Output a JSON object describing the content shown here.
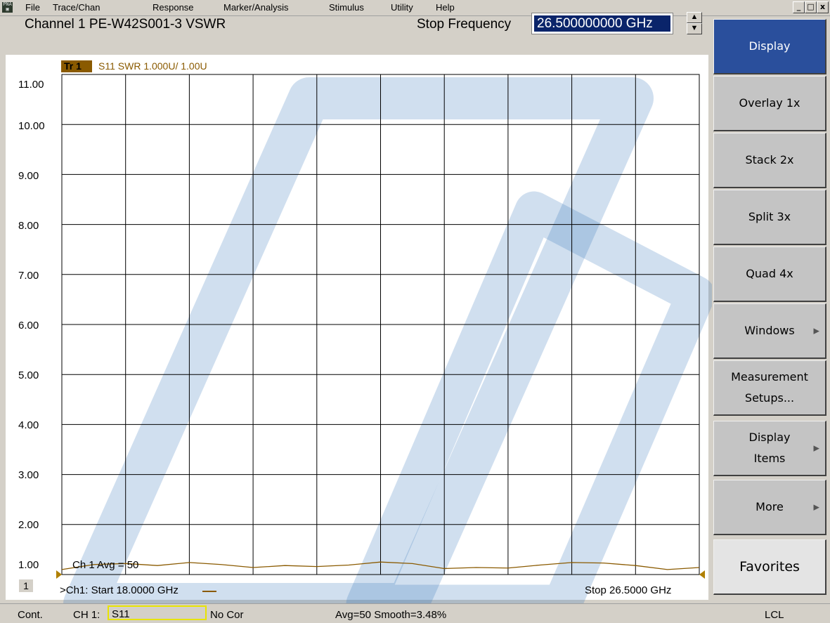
{
  "menubar": {
    "items": [
      "File",
      "Trace/Chan",
      "Response",
      "Marker/Analysis",
      "Stimulus",
      "Utility",
      "Help"
    ],
    "icon": "pna-app-icon",
    "window_buttons": {
      "minimize": "_",
      "restore": "□",
      "close": "x"
    }
  },
  "header": {
    "channel_title": "Channel 1  PE-W42S001-3 VSWR",
    "stop_label": "Stop Frequency",
    "stop_value": "26.500000000 GHz"
  },
  "trace": {
    "tag": "Tr  1",
    "label": "S11 SWR 1.000U/  1.00U",
    "color": "#8a5a00"
  },
  "chart_data": {
    "type": "line",
    "xlabel": "",
    "ylabel": "",
    "xlim": [
      18.0,
      26.5
    ],
    "ylim": [
      1.0,
      11.0
    ],
    "y_ticks": [
      "11.00",
      "10.00",
      "9.00",
      "8.00",
      "7.00",
      "6.00",
      "5.00",
      "4.00",
      "3.00",
      "2.00",
      "1.00"
    ],
    "grid": true,
    "series": [
      {
        "name": "S11",
        "color": "#8a5a00",
        "x": [
          18.0,
          18.425,
          18.85,
          19.275,
          19.7,
          20.125,
          20.55,
          20.975,
          21.4,
          21.825,
          22.25,
          22.675,
          23.1,
          23.525,
          23.95,
          24.375,
          24.8,
          25.225,
          25.65,
          26.075,
          26.5
        ],
        "y": [
          1.1,
          1.2,
          1.22,
          1.18,
          1.24,
          1.2,
          1.14,
          1.18,
          1.16,
          1.19,
          1.25,
          1.22,
          1.12,
          1.14,
          1.13,
          1.19,
          1.24,
          1.23,
          1.18,
          1.1,
          1.14
        ]
      }
    ]
  },
  "plot": {
    "channel_number": "1",
    "start_text": ">Ch1: Start  18.0000 GHz",
    "stop_text": "Stop  26.5000 GHz",
    "avg_text": "Ch 1 Avg =    50"
  },
  "softkeys": [
    {
      "label": "Display",
      "active": true
    },
    {
      "label": "Overlay 1x"
    },
    {
      "label": "Stack 2x"
    },
    {
      "label": "Split 3x"
    },
    {
      "label": "Quad 4x"
    },
    {
      "label": "Windows",
      "arrow": true
    },
    {
      "label": "Measurement Setups...",
      "line1": "Measurement",
      "line2": "Setups..."
    },
    {
      "label": "Display Items",
      "line1": "Display",
      "line2": "Items",
      "arrow": true
    },
    {
      "label": "More",
      "arrow": true
    },
    {
      "label": "Favorites"
    }
  ],
  "statusbar": {
    "mode": "Cont.",
    "channel": "CH 1:",
    "measurement": "S11",
    "correction": "No Cor",
    "averaging": "Avg=50 Smooth=3.48%",
    "remote": "LCL"
  }
}
